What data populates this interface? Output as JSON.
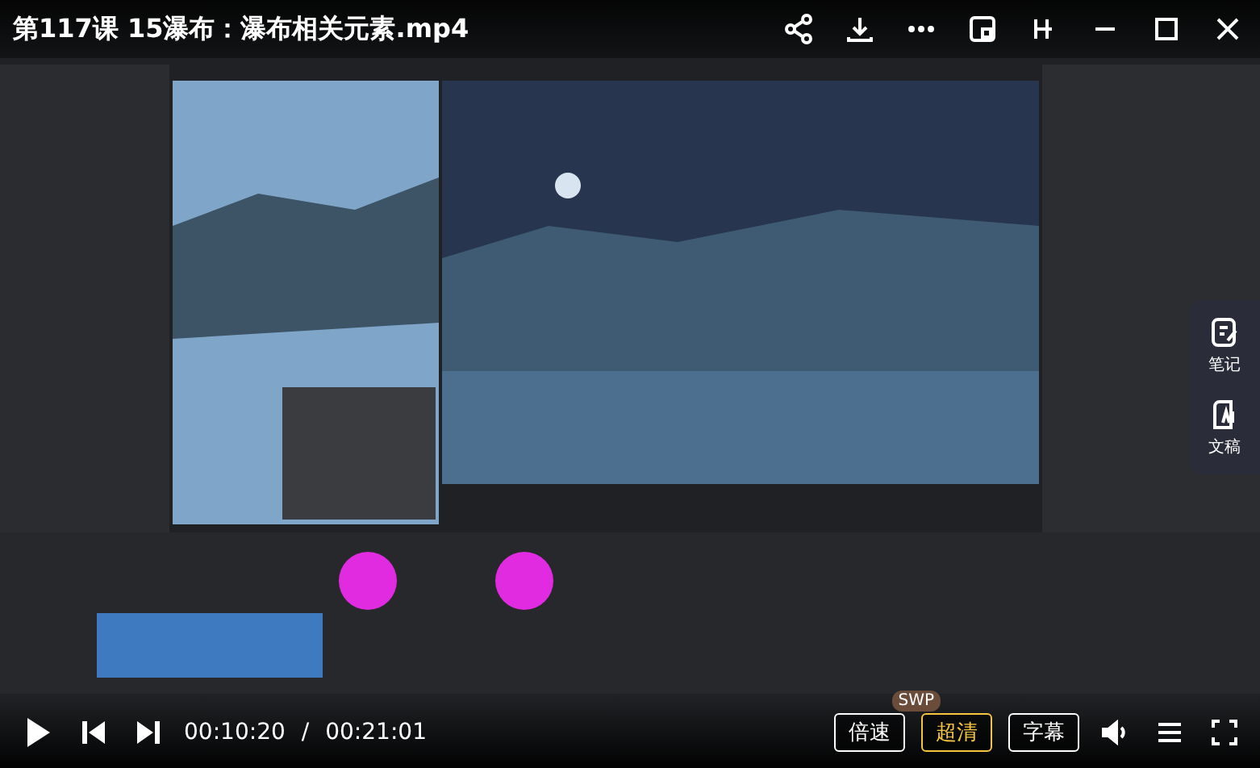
{
  "title": "第117课 15瀑布：瀑布相关元素.mp4",
  "side_panel": [
    {
      "label": "笔记"
    },
    {
      "label": "文稿"
    }
  ],
  "controls": {
    "playing": false,
    "current_time": "00:10:20",
    "separator": "/",
    "duration": "00:21:01",
    "buttons": [
      {
        "label": "倍速",
        "highlighted": false,
        "badge": "SWP"
      },
      {
        "label": "超清",
        "highlighted": true
      },
      {
        "label": "字幕",
        "highlighted": false
      }
    ]
  }
}
